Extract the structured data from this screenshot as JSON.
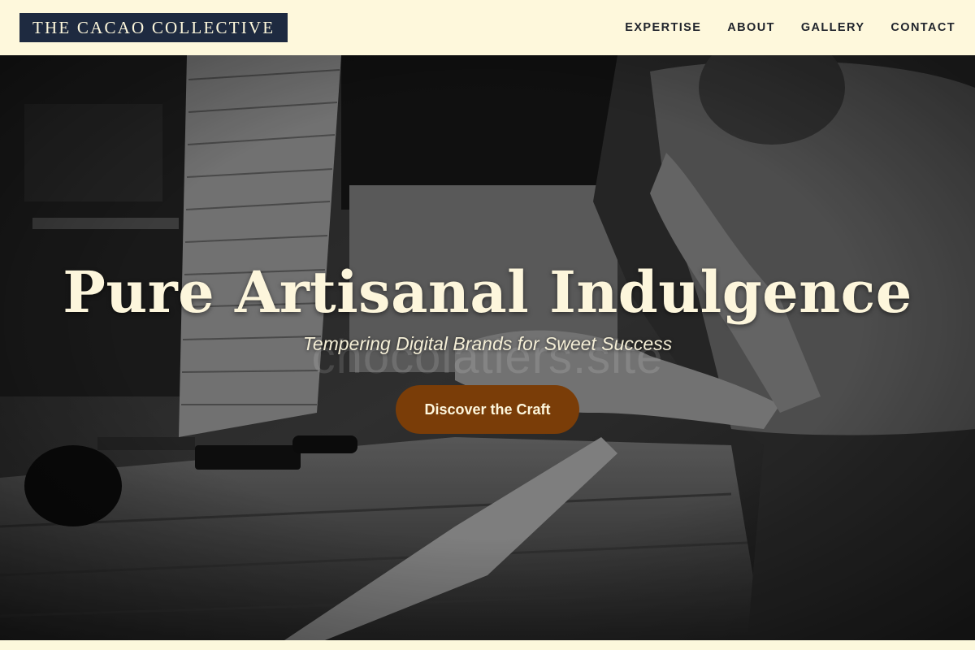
{
  "brand": {
    "name": "THE CACAO COLLECTIVE"
  },
  "nav": {
    "items": [
      "EXPERTISE",
      "ABOUT",
      "GALLERY",
      "CONTACT"
    ]
  },
  "hero": {
    "title": "Pure Artisanal Indulgence",
    "subtitle": "Tempering Digital Brands for Sweet Success",
    "cta_label": "Discover the Craft",
    "watermark": "chocolatiers.site",
    "image": "black-and-white photo of a craftsman working at a wooden workbench"
  },
  "colors": {
    "nav_bg": "#fef8dc",
    "brand_bg": "#1e2a40",
    "cta_bg": "#7a3d08",
    "text_light": "#fdf6dc"
  }
}
